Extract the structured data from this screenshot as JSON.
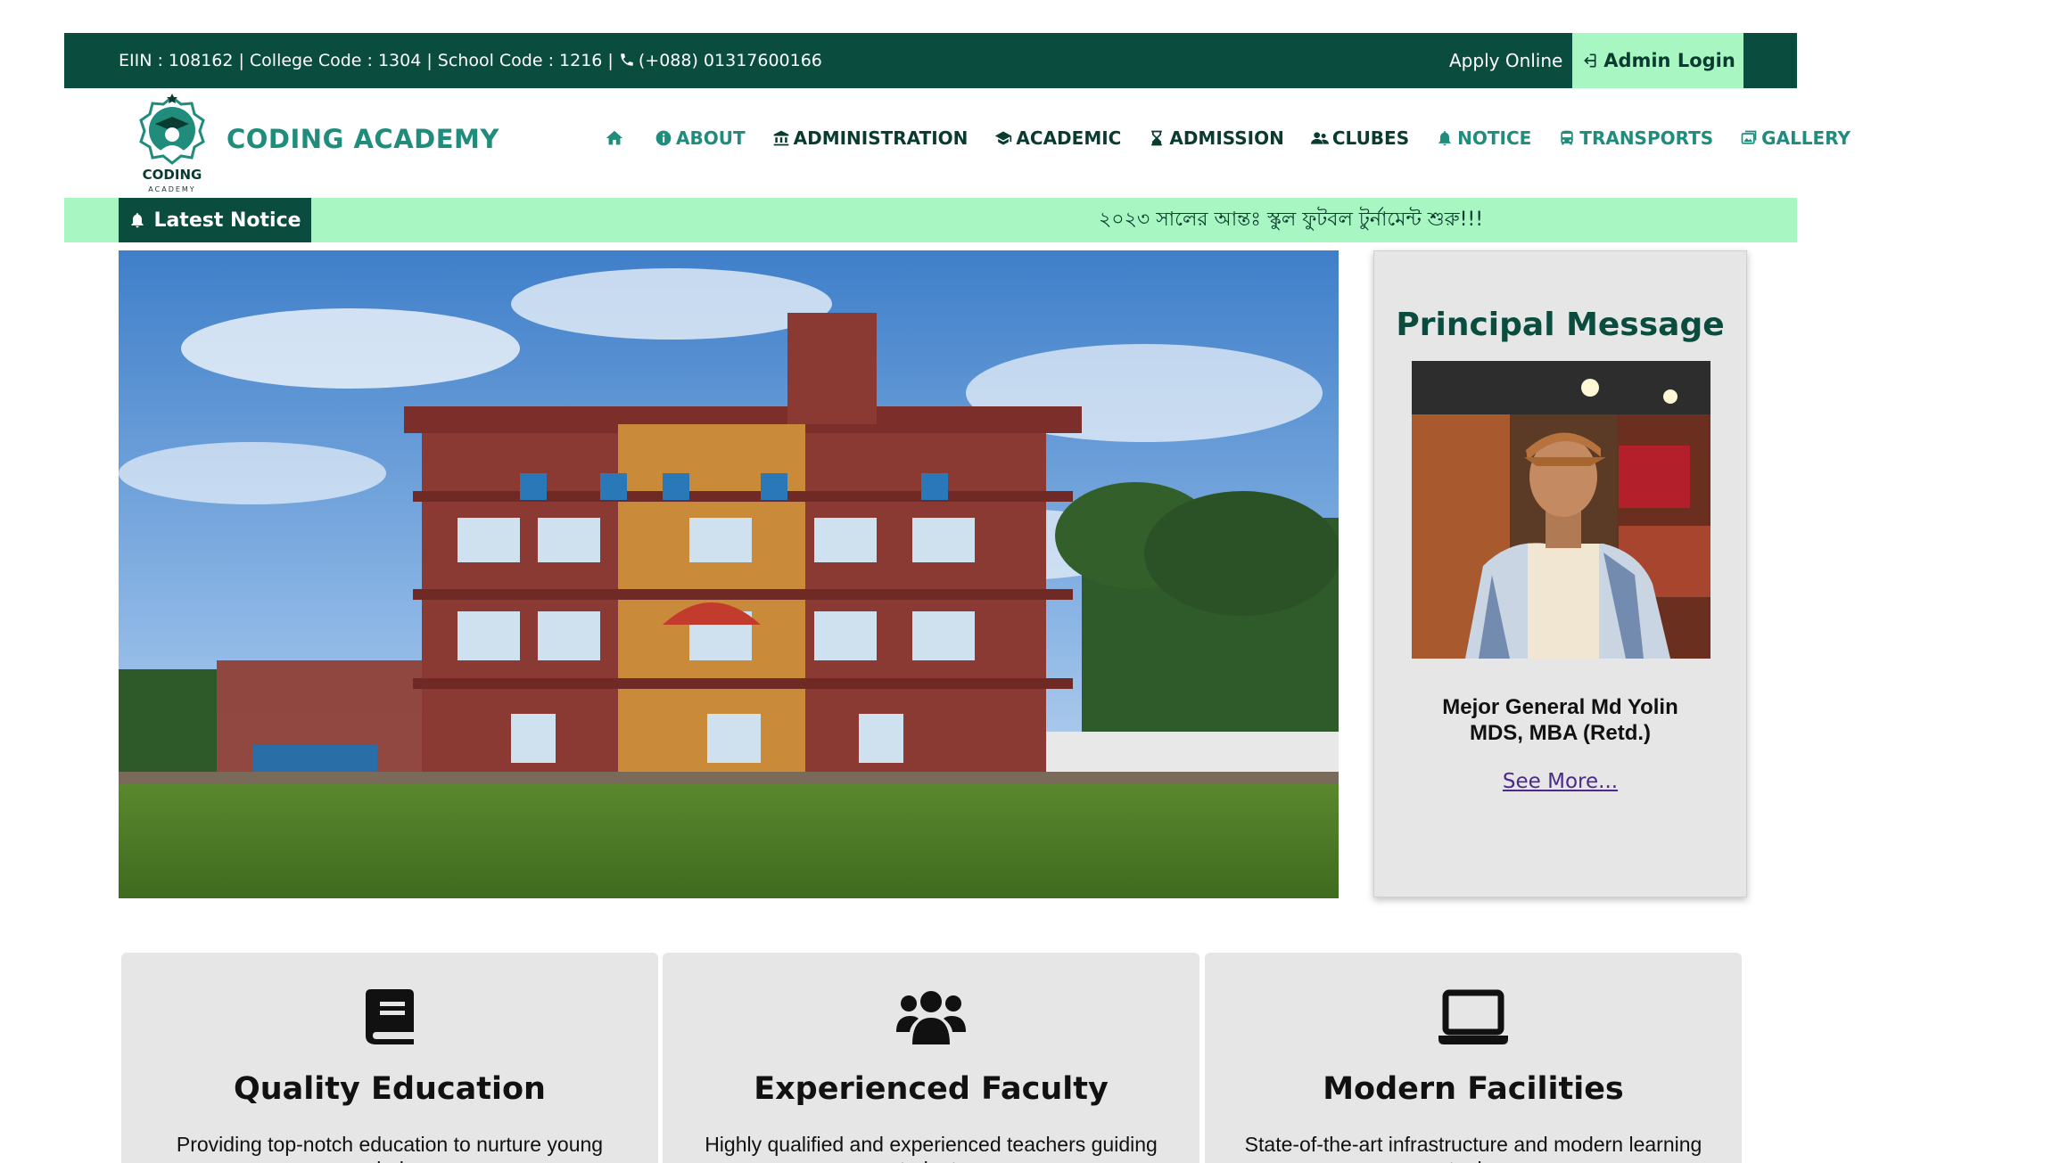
{
  "topbar": {
    "info": "EIIN : 108162 | College Code : 1304 | School Code : 1216 | ",
    "phone": "(+088) 01317600166",
    "apply_label": "Apply Online",
    "admin_label": "Admin Login"
  },
  "brand": {
    "name": "CODING ACADEMY",
    "logo_text": "CODING",
    "logo_subtext": "ACADEMY"
  },
  "nav": {
    "items": [
      {
        "label": "",
        "icon": "home-icon",
        "color": "#1f8c7c"
      },
      {
        "label": "ABOUT",
        "icon": "info-icon",
        "color": "#1f8c7c"
      },
      {
        "label": "ADMINISTRATION",
        "icon": "bank-icon",
        "color": "#0a3b30"
      },
      {
        "label": "ACADEMIC",
        "icon": "graduation-cap-icon",
        "color": "#0a3b30"
      },
      {
        "label": "ADMISSION",
        "icon": "hourglass-icon",
        "color": "#0a3b30"
      },
      {
        "label": "CLUBES",
        "icon": "users-icon",
        "color": "#0a3b30"
      },
      {
        "label": "NOTICE",
        "icon": "bell-icon",
        "color": "#1f8c7c"
      },
      {
        "label": "TRANSPORTS",
        "icon": "bus-icon",
        "color": "#1f8c7c"
      },
      {
        "label": "GALLERY",
        "icon": "image-icon",
        "color": "#1f8c7c"
      }
    ]
  },
  "ticker": {
    "label": "Latest Notice",
    "message": "২০২৩ সালের আন্তঃ স্কুল ফুটবল টুর্নামেন্ট শুরু!!!"
  },
  "principal": {
    "title": "Principal Message",
    "name_line1": "Mejor General Md Yolin",
    "name_line2": "MDS, MBA (Retd.)",
    "more_label": "See More..."
  },
  "features": [
    {
      "title": "Quality Education",
      "desc": "Providing top-notch education to nurture young minds.",
      "icon": "book-icon"
    },
    {
      "title": "Experienced Faculty",
      "desc": "Highly qualified and experienced teachers guiding students.",
      "icon": "users-icon"
    },
    {
      "title": "Modern Facilities",
      "desc": "State-of-the-art infrastructure and modern learning tools.",
      "icon": "laptop-icon"
    }
  ],
  "colors": {
    "primary_dark": "#0a4d3f",
    "accent_mint": "#a8f7c2",
    "teal": "#1f8c7c"
  }
}
